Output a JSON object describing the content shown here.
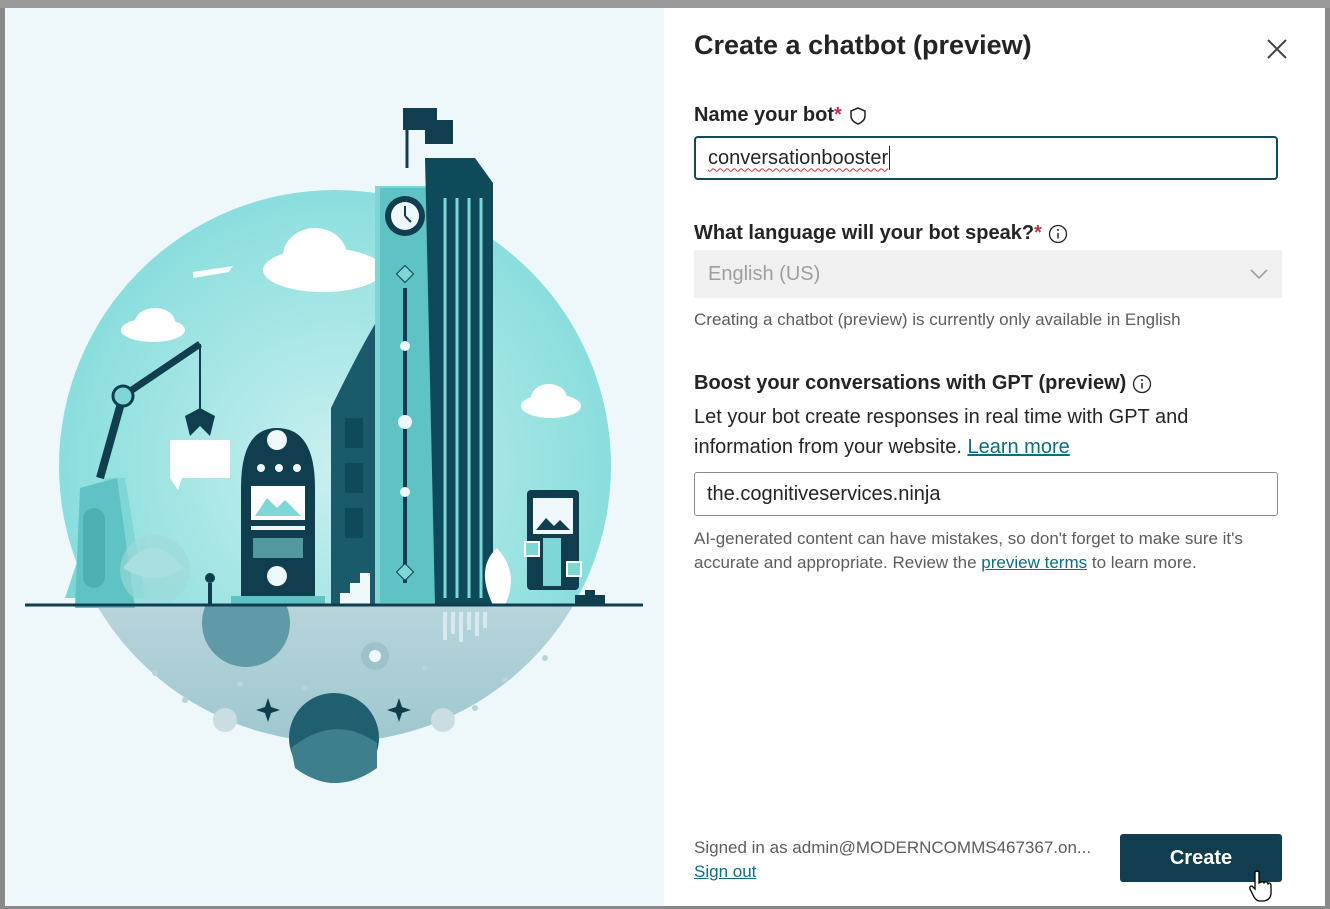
{
  "dialog": {
    "title": "Create a chatbot (preview)",
    "close_icon": "close-icon"
  },
  "name_field": {
    "label": "Name your bot",
    "required_mark": "*",
    "value": "conversationbooster",
    "icon": "shield-icon"
  },
  "language_field": {
    "label": "What language will your bot speak?",
    "required_mark": "*",
    "icon": "info-icon",
    "selected": "English (US)",
    "hint": "Creating a chatbot (preview) is currently only available in English"
  },
  "gpt_section": {
    "label": "Boost your conversations with GPT (preview)",
    "icon": "info-icon",
    "description": "Let your bot create responses in real time with GPT and information from your website.",
    "learn_more": "Learn more",
    "website_value": "the.cognitiveservices.ninja",
    "disclaimer_pre": "AI-generated content can have mistakes, so don't forget to make sure it's accurate and appropriate. Review the",
    "preview_terms": "preview terms",
    "disclaimer_post": "to learn more."
  },
  "footer": {
    "signed_in": "Signed in as admin@MODERNCOMMS467367.on...",
    "sign_out": "Sign out",
    "create_label": "Create"
  },
  "colors": {
    "primary": "#103e4f",
    "link": "#0f6b7e",
    "illustration_bg": "#eef8fa",
    "teal": "#7fd6d6",
    "dark_teal": "#0f4a5b",
    "required": "#c4314b"
  }
}
